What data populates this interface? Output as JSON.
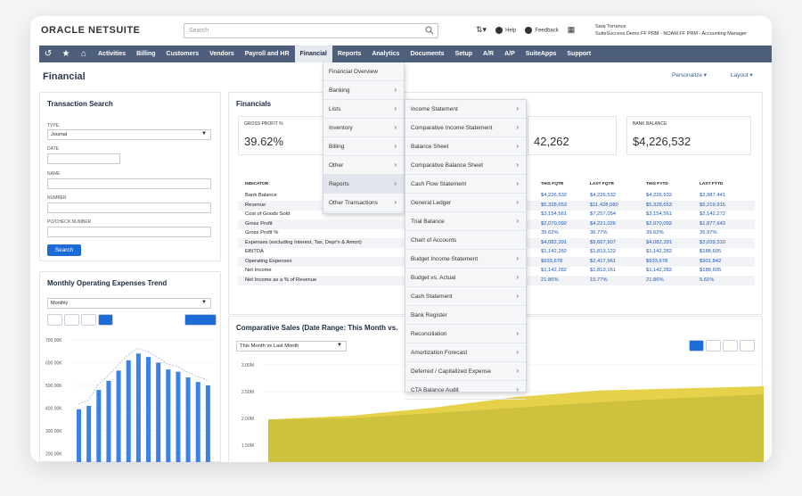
{
  "header": {
    "logo_bold": "ORACLE NETSUITE",
    "logo_light": "",
    "search_placeholder": "Search",
    "help": "Help",
    "feedback": "Feedback",
    "user_name": "Sara Torrance",
    "user_role": "SuiteSuccess Demo FF PRM - NOAM FF PRM - Accounting Manager"
  },
  "nav": {
    "items": [
      "Activities",
      "Billing",
      "Customers",
      "Vendors",
      "Payroll and HR",
      "Financial",
      "Reports",
      "Analytics",
      "Documents",
      "Setup",
      "A/R",
      "A/P",
      "SuiteApps",
      "Support"
    ],
    "active": "Financial"
  },
  "page": {
    "title": "Financial",
    "personalize": "Personalize ▾",
    "layout": "Layout ▾"
  },
  "txn": {
    "title": "Transaction Search",
    "type_label": "TYPE",
    "type_value": "Journal",
    "date_label": "DATE",
    "name_label": "NAME",
    "number_label": "NUMBER",
    "po_label": "PO/CHECK NUMBER",
    "button": "Search"
  },
  "trend": {
    "title": "Monthly Operating Expenses Trend",
    "period": "Monthly",
    "ticks": [
      "700.00K",
      "600.00K",
      "500.00K",
      "400.00K",
      "300.00K",
      "200.00K"
    ],
    "chart_data": {
      "type": "bar",
      "title": "Monthly Operating Expenses Trend",
      "ylim": [
        0,
        700000
      ],
      "values": [
        395000,
        410000,
        480000,
        520000,
        565000,
        610000,
        640000,
        625000,
        600000,
        570000,
        560000,
        535000,
        515000,
        500000
      ]
    }
  },
  "fin": {
    "title": "Financials",
    "kpi": [
      {
        "label": "GROSS PROFIT %",
        "value": "39.62%"
      },
      {
        "label": "BANK BALANCE",
        "value": "$4,226,532"
      },
      {
        "label": "",
        "value": "42,262"
      }
    ],
    "cols": [
      "INDICATOR",
      "THIS FQTR",
      "LAST FQTR",
      "THIS FYTD",
      "LAST FYTD"
    ],
    "rows": [
      {
        "name": "Bank Balance",
        "v": [
          "$4,226,532",
          "$4,226,532",
          "$4,226,532",
          "$2,987,441"
        ]
      },
      {
        "name": "Revenue",
        "v": [
          "$5,328,653",
          "$11,428,080",
          "$5,328,653",
          "$5,219,915"
        ]
      },
      {
        "name": "Cost of Goods Sold",
        "v": [
          "$3,154,561",
          "$7,257,054",
          "$3,154,561",
          "$2,142,272"
        ]
      },
      {
        "name": "Gross Profit",
        "v": [
          "$2,070,092",
          "$4,221,026",
          "$2,070,092",
          "$1,877,643"
        ]
      },
      {
        "name": "Gross Profit %",
        "v": [
          "39.62%",
          "36.77%",
          "39.62%",
          "35.97%"
        ]
      },
      {
        "name": "Expenses (excluding Interest, Tax, Depr'n & Amort)",
        "v": [
          "$4,082,391",
          "$9,667,907",
          "$4,082,391",
          "$3,039,310"
        ]
      },
      {
        "name": "EBITDA",
        "v": [
          "$1,142,282",
          "$1,813,122",
          "$1,142,282",
          "$188,605"
        ]
      },
      {
        "name": "Operating Expenses",
        "v": [
          "$933,678",
          "$2,417,961",
          "$933,678",
          "$901,842"
        ]
      },
      {
        "name": "Net Income",
        "v": [
          "$1,142,282",
          "$1,813,161",
          "$1,142,282",
          "$188,605"
        ]
      },
      {
        "name": "Net Income as a % of Revenue",
        "v": [
          "21.86%",
          "15.77%",
          "21.86%",
          "5.61%"
        ]
      }
    ]
  },
  "comp": {
    "title": "Comparative Sales (Date Range: This Month vs.",
    "range": "This Month vs Last Month",
    "ticks": [
      "3.00M",
      "2.50M",
      "2.00M",
      "1.50M",
      "1.00M"
    ],
    "chart_data": {
      "type": "area",
      "title": "Comparative Sales (Date Range: This Month vs.",
      "ylim": [
        1000000,
        3000000
      ],
      "series": [
        {
          "values": [
            1980000,
            2050000,
            2200000,
            2400000,
            2520000,
            2560000,
            2600000
          ]
        },
        {
          "values": [
            1980000,
            2000000,
            2100000,
            2200000,
            2300000,
            2380000,
            2450000
          ]
        }
      ]
    }
  },
  "menu_financial": [
    {
      "label": "Financial Overview",
      "arrow": false
    },
    {
      "label": "Banking",
      "arrow": true
    },
    {
      "label": "Lists",
      "arrow": true
    },
    {
      "label": "Inventory",
      "arrow": true
    },
    {
      "label": "Billing",
      "arrow": true
    },
    {
      "label": "Other",
      "arrow": true
    },
    {
      "label": "Reports",
      "arrow": true
    },
    {
      "label": "Other Transactions",
      "arrow": true
    }
  ],
  "menu_reports": [
    {
      "label": "Income Statement",
      "arrow": true
    },
    {
      "label": "Comparative Income Statement",
      "arrow": true
    },
    {
      "label": "Balance Sheet",
      "arrow": true
    },
    {
      "label": "Comparative Balance Sheet",
      "arrow": true
    },
    {
      "label": "Cash Flow Statement",
      "arrow": true
    },
    {
      "label": "General Ledger",
      "arrow": true
    },
    {
      "label": "Trial Balance",
      "arrow": true
    },
    {
      "label": "Chart of Accounts",
      "arrow": false
    },
    {
      "label": "Budget Income Statement",
      "arrow": true
    },
    {
      "label": "Budget vs. Actual",
      "arrow": true
    },
    {
      "label": "Cash Statement",
      "arrow": true
    },
    {
      "label": "Bank Register",
      "arrow": false
    },
    {
      "label": "Reconciliation",
      "arrow": true
    },
    {
      "label": "Amortization Forecast",
      "arrow": true
    },
    {
      "label": "Deferred / Capitalized Expense",
      "arrow": true
    },
    {
      "label": "CTA Balance Audit",
      "arrow": true
    }
  ],
  "colors": {
    "nav_bg": "#4d5f7a",
    "accent": "#1c6bd6",
    "bars": "#3c82e6",
    "area_yellow": "#e6d24a"
  }
}
